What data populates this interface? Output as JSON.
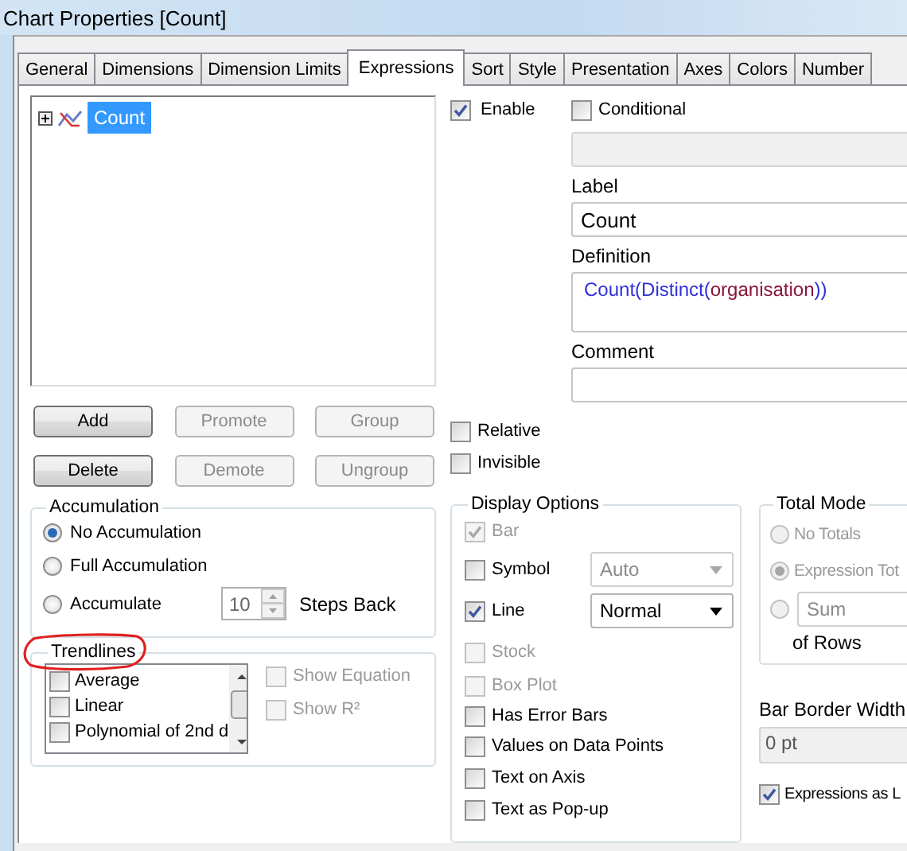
{
  "window": {
    "title": "Chart Properties [Count]"
  },
  "tabs": [
    {
      "label": "General",
      "selected": false
    },
    {
      "label": "Dimensions",
      "selected": false
    },
    {
      "label": "Dimension Limits",
      "selected": false
    },
    {
      "label": "Expressions",
      "selected": true
    },
    {
      "label": "Sort",
      "selected": false
    },
    {
      "label": "Style",
      "selected": false
    },
    {
      "label": "Presentation",
      "selected": false
    },
    {
      "label": "Axes",
      "selected": false
    },
    {
      "label": "Colors",
      "selected": false
    },
    {
      "label": "Number",
      "selected": false
    }
  ],
  "expressions": [
    {
      "label": "Count",
      "selected": true,
      "expanded": false
    }
  ],
  "buttons": [
    {
      "label": "Add",
      "disabled": false
    },
    {
      "label": "Promote",
      "disabled": true
    },
    {
      "label": "Group",
      "disabled": true
    },
    {
      "label": "Delete",
      "disabled": false
    },
    {
      "label": "Demote",
      "disabled": true
    },
    {
      "label": "Ungroup",
      "disabled": true
    }
  ],
  "accumulation": {
    "title": "Accumulation",
    "options": [
      {
        "label": "No Accumulation",
        "selected": true
      },
      {
        "label": "Full Accumulation",
        "selected": false
      },
      {
        "label": "Accumulate",
        "selected": false
      }
    ],
    "steps": {
      "value": "10",
      "disabled": true
    },
    "steps_label": "Steps Back"
  },
  "trendlines": {
    "title": "Trendlines",
    "annotated": true,
    "items": [
      {
        "label": "Average",
        "checked": false
      },
      {
        "label": "Linear",
        "checked": false
      },
      {
        "label": "Polynomial of 2nd d",
        "checked": false
      }
    ],
    "options": [
      {
        "label": "Show Equation",
        "checked": false,
        "disabled": true
      },
      {
        "label": "Show R²",
        "checked": false,
        "disabled": true
      }
    ]
  },
  "enable": {
    "label": "Enable",
    "checked": true
  },
  "conditional": {
    "label": "Conditional",
    "checked": false,
    "field_disabled": true
  },
  "label_field": {
    "label": "Label",
    "value": "Count"
  },
  "definition": {
    "label": "Definition",
    "tokens": [
      {
        "text": "Count(",
        "kind": "function"
      },
      {
        "text": "Distinct(",
        "kind": "function"
      },
      {
        "text": "organisation",
        "kind": "field"
      },
      {
        "text": "))",
        "kind": "function"
      }
    ]
  },
  "comment": {
    "label": "Comment"
  },
  "relative": {
    "label": "Relative",
    "checked": false
  },
  "invisible": {
    "label": "Invisible",
    "checked": false
  },
  "display_options": {
    "title": "Display Options",
    "items": [
      {
        "label": "Bar",
        "checked": true,
        "disabled": true
      },
      {
        "label": "Symbol",
        "checked": false,
        "disabled": false,
        "dropdown": {
          "value": "Auto",
          "disabled": true
        }
      },
      {
        "label": "Line",
        "checked": true,
        "disabled": false,
        "dropdown": {
          "value": "Normal",
          "disabled": false
        }
      },
      {
        "label": "Stock",
        "checked": false,
        "disabled": true
      },
      {
        "label": "Box Plot",
        "checked": false,
        "disabled": true
      },
      {
        "label": "Has Error Bars",
        "checked": false,
        "disabled": false
      },
      {
        "label": "Values on Data Points",
        "checked": false,
        "disabled": false
      },
      {
        "label": "Text on Axis",
        "checked": false,
        "disabled": false
      },
      {
        "label": "Text as Pop-up",
        "checked": false,
        "disabled": false
      }
    ]
  },
  "total_mode": {
    "title": "Total Mode",
    "options": [
      {
        "kind": "label",
        "label": "No Totals",
        "selected": false,
        "disabled": true
      },
      {
        "kind": "label",
        "label": "Expression Tot",
        "selected": true,
        "disabled": true
      },
      {
        "kind": "dropdown",
        "value": "Sum",
        "selected": false,
        "disabled": true
      }
    ],
    "suffix": "of Rows"
  },
  "bar_border_width": {
    "label": "Bar Border Width",
    "value": "0 pt",
    "disabled": true
  },
  "expressions_as_legend": {
    "label": "Expressions as L",
    "checked": true
  }
}
